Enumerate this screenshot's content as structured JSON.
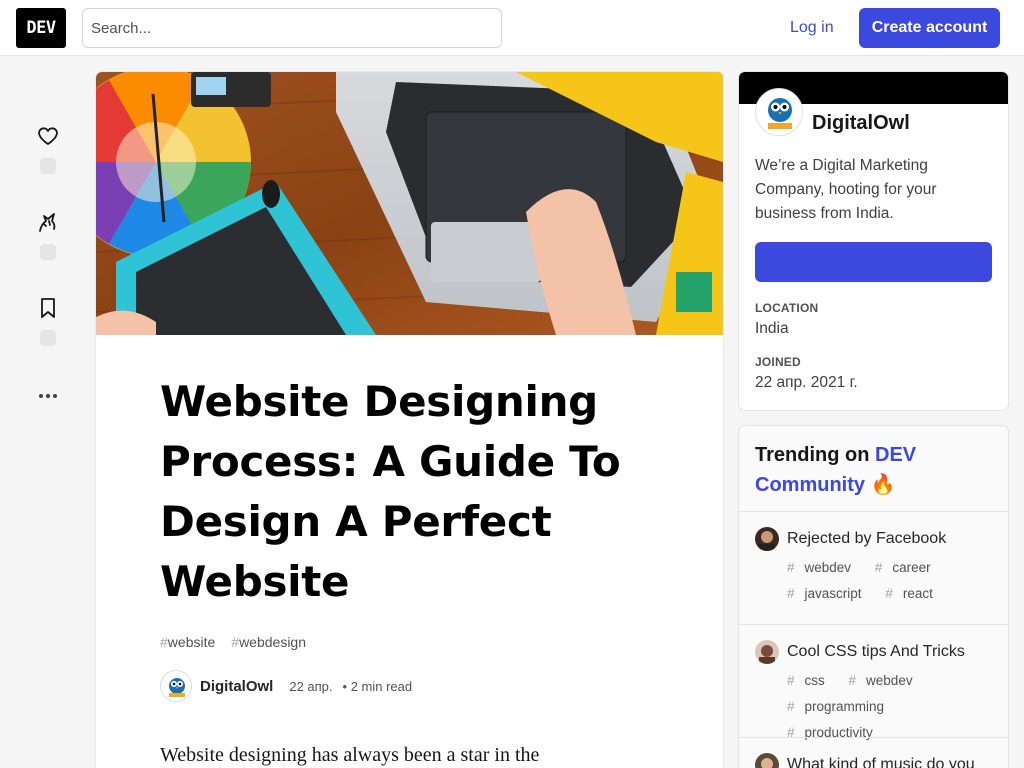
{
  "header": {
    "logo": "DEV",
    "search_placeholder": "Search...",
    "login": "Log in",
    "create_account": "Create account"
  },
  "colors": {
    "accent": "#3b49df",
    "logo_bg": "#000000"
  },
  "actions": [
    {
      "name": "heart-icon"
    },
    {
      "name": "unicorn-icon"
    },
    {
      "name": "bookmark-icon"
    },
    {
      "name": "more-icon"
    }
  ],
  "article": {
    "title": "Website Designing Process: A Guide To Design A Perfect Website",
    "tags": [
      {
        "hash": "#",
        "name": "website"
      },
      {
        "hash": "#",
        "name": "webdesign"
      }
    ],
    "author": "DigitalOwl",
    "date": "22 апр.",
    "read_time": "• 2 min read",
    "intro": "Website designing has always been a star in the"
  },
  "profile": {
    "name": "DigitalOwl",
    "description": "We’re a Digital Marketing Company, hooting for your business from India.",
    "location_label": "Location",
    "location": "India",
    "joined_label": "Joined",
    "joined": "22 апр. 2021 г."
  },
  "trending": {
    "heading_prefix": "Trending on",
    "heading_accent": "DEV Community",
    "fire": "🔥",
    "items": [
      {
        "title": "Rejected by Facebook",
        "tags": [
          "webdev",
          "career",
          "javascript",
          "react"
        ]
      },
      {
        "title": "Cool CSS tips And Tricks",
        "tags": [
          "css",
          "webdev",
          "programming",
          "productivity"
        ]
      },
      {
        "title": "What kind of music do you",
        "tags": []
      }
    ]
  }
}
